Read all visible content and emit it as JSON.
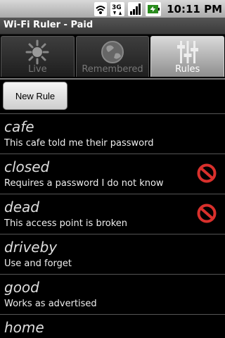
{
  "status": {
    "time": "10:11 PM",
    "icons": [
      "wifi-icon",
      "3g-icon",
      "signal-icon",
      "battery-icon"
    ],
    "network_label": "3G"
  },
  "app": {
    "title": "Wi-Fi Ruler - Paid"
  },
  "tabs": [
    {
      "label": "Live",
      "icon": "sun-icon",
      "selected": false
    },
    {
      "label": "Remembered",
      "icon": "globe-icon",
      "selected": false
    },
    {
      "label": "Rules",
      "icon": "sliders-icon",
      "selected": true
    }
  ],
  "new_rule_label": "New Rule",
  "rules": [
    {
      "name": "cafe",
      "description": "This cafe told me their password",
      "blocked": false
    },
    {
      "name": "closed",
      "description": "Requires a password I do not know",
      "blocked": true
    },
    {
      "name": "dead",
      "description": "This access point is broken",
      "blocked": true
    },
    {
      "name": "driveby",
      "description": "Use and forget",
      "blocked": false
    },
    {
      "name": "good",
      "description": "Works as advertised",
      "blocked": false
    },
    {
      "name": "home",
      "description": "",
      "blocked": false
    }
  ],
  "colors": {
    "block": "#d9302c",
    "tab_selected": "#bdbdbd"
  }
}
